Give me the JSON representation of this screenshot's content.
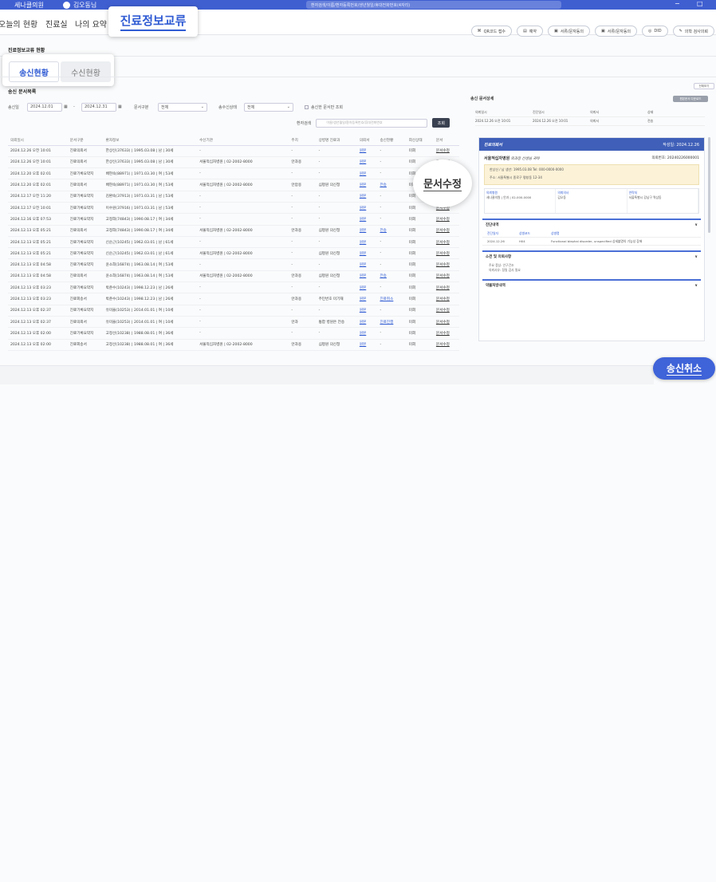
{
  "topbar": {
    "clinic_name": "세나클의원",
    "user_name": "김오동님",
    "search_placeholder": "환자검색/이름/환자등록번호/생년월일/휴대전화번호(4자리)",
    "minimize": "−",
    "maximize": "□"
  },
  "menu": {
    "items": [
      "오늘의 현황",
      "진료실",
      "나의 요약"
    ],
    "active": "진료정보교류"
  },
  "actions": [
    {
      "icon": "qr-icon",
      "glyph": "⌘",
      "label": "QR코드 접수"
    },
    {
      "icon": "print-icon",
      "glyph": "▤",
      "label": "예약"
    },
    {
      "icon": "doc-icon",
      "glyph": "▣",
      "label": "서류/문자동의"
    },
    {
      "icon": "doc2-icon",
      "glyph": "▣",
      "label": "서류/문자동의"
    },
    {
      "icon": "did-icon",
      "glyph": "◎",
      "label": "DID"
    },
    {
      "icon": "pen-icon",
      "glyph": "✎",
      "label": "의학 검사의뢰"
    }
  ],
  "page": {
    "title": "진료정보교류 현황",
    "tabs": {
      "sent": "송신현황",
      "received": "수신현황"
    },
    "small_right_button": "전체보기"
  },
  "list": {
    "title": "송신 문서목록",
    "filters": {
      "send_date_label": "송신일",
      "date_from": "2024.12.01",
      "date_to": "2024.12.31",
      "doc_type_label": "문서구분",
      "doc_type_value": "전체",
      "status_label": "송수신상태",
      "status_value": "전체",
      "checkbox_label": "송신한 문서만 조회"
    },
    "search": {
      "label": "환자검색",
      "placeholder": "이름/생년월일/환자등록번호/휴대전화번호",
      "button": "조회"
    },
    "columns": [
      "의뢰일시",
      "문서구분",
      "환자정보",
      "수신기관",
      "주치",
      "상병명 진료과",
      "의뢰서",
      "송신현황",
      "회신상태",
      "문서"
    ],
    "rows": [
      [
        "2024.12.26 오전 10:01",
        "진료의뢰서",
        "한상신(37633) | 1995.03.08 | 남 | 30세",
        "-",
        "-",
        "-",
        "원본",
        "-",
        "미회",
        "문서수정"
      ],
      [
        "2024.12.26 오전 10:01",
        "진료의뢰서",
        "한상신(37633) | 1995.03.08 | 남 | 30세",
        "서울적십자병원 | 02-2002-8000",
        "안과용",
        "-",
        "원본",
        "-",
        "미회",
        "문서수정"
      ],
      [
        "2024.12.20 오후 02:01",
        "진료기록요약지",
        "배현숙(88971) | 1971.03.30 | 여 | 53세",
        "-",
        "-",
        "-",
        "원본",
        "-",
        "미회",
        "문서수정"
      ],
      [
        "2024.12.20 오후 02:01",
        "진료의뢰서",
        "배현숙(88971) | 1971.03.30 | 여 | 53세",
        "서울적십자병원 | 02-2002-8000",
        "안압용",
        "심평원 의신청",
        "원본",
        "전송",
        "미회",
        "문서수정"
      ],
      [
        "2024.12.17 오전 11:20",
        "진료기록요약지",
        "김환숙(37913) | 1971.03.31 | 남 | 53세",
        "-",
        "-",
        "-",
        "원본",
        "-",
        "미회",
        "문서수정"
      ],
      [
        "2024.12.17 오전 10:01",
        "진료기록요약지",
        "이수원(37916) | 1971.03.31 | 남 | 53세",
        "-",
        "-",
        "-",
        "원본",
        "-",
        "미회",
        "문서수정"
      ],
      [
        "2024.12.16 오후 07:53",
        "진료기록요약지",
        "고정희(74843) | 1990.08.17 | 여 | 34세",
        "-",
        "-",
        "-",
        "원본",
        "-",
        "미회",
        "문서수정"
      ],
      [
        "2024.12.13 오후 05:21",
        "진료의뢰서",
        "고정희(74843) | 1990.08.17 | 여 | 34세",
        "서울적십자병원 | 02-2002-8000",
        "안과용",
        "심평원 의신청",
        "원본",
        "전송",
        "미회",
        "문서수정"
      ],
      [
        "2024.12.13 오후 05:21",
        "진료기록요약지",
        "신순근(10245) | 1962.03.01 | 남 | 61세",
        "-",
        "-",
        "-",
        "원본",
        "-",
        "미회",
        "문서수정"
      ],
      [
        "2024.12.13 오후 05:21",
        "진료기록요약지",
        "신순근(10245) | 1962.03.01 | 남 | 61세",
        "서울적십자병원 | 02-2002-8000",
        "-",
        "심평원 의신청",
        "원본",
        "-",
        "미회",
        "문서수정"
      ],
      [
        "2024.12.13 오후 04:58",
        "진료기록요약지",
        "윤소희(16874) | 1963.08.14 | 여 | 53세",
        "-",
        "-",
        "-",
        "원본",
        "-",
        "미회",
        "문서수정"
      ],
      [
        "2024.12.13 오후 04:58",
        "진료의뢰서",
        "윤소희(16874) | 1963.08.14 | 여 | 53세",
        "서울적십자병원 | 02-2002-8000",
        "안과용",
        "심평원 의신청",
        "원본",
        "전송",
        "미회",
        "문서수정"
      ],
      [
        "2024.12.13 오후 03:23",
        "진료기록요약지",
        "박춘수(10243) | 1998.12.23 | 남 | 26세",
        "-",
        "-",
        "-",
        "원본",
        "-",
        "미회",
        "문서수정"
      ],
      [
        "2024.12.13 오후 03:23",
        "진료회송서",
        "박춘수(10243) | 1998.12.23 | 남 | 26세",
        "-",
        "안과용",
        "주민번호 미기재",
        "원본",
        "진료취소",
        "미회",
        "문서수정"
      ],
      [
        "2024.12.13 오후 02:37",
        "진료기록요약지",
        "유미을(10253) | 2014.01.01 | 여 | 10세",
        "-",
        "-",
        "-",
        "원본",
        "-",
        "미회",
        "문서수정"
      ],
      [
        "2024.12.13 오후 02:37",
        "진료의뢰서",
        "유미을(10253) | 2014.01.01 | 여 | 10세",
        "-",
        "안과",
        "통합 병원은 전송",
        "원본",
        "진료진행",
        "미회",
        "문서수정"
      ],
      [
        "2024.12.13 오후 02:00",
        "진료기록요약지",
        "고정선(10238) | 1988.08.01 | 여 | 36세",
        "-",
        "-",
        "-",
        "원본",
        "-",
        "미회",
        "문서수정"
      ],
      [
        "2024.12.13 오후 02:00",
        "진료회송서",
        "고정선(10238) | 1988.08.01 | 여 | 36세",
        "서울적십자병원 | 02-2002-8000",
        "안과용",
        "심평원 의신청",
        "원본",
        "-",
        "미회",
        "문서수정"
      ]
    ],
    "zoom_label": "문서수정"
  },
  "detail": {
    "title": "송신 문서상세",
    "top_button": "원본문서 다운로드",
    "info_headers": [
      "의뢰일시",
      "진단일시",
      "의뢰서",
      "상태"
    ],
    "info_values": [
      "2024.12.26 오전 10:01",
      "2024.12.26 오전 10:01",
      "의뢰서",
      "전송"
    ],
    "doc_header_title": "진료의뢰서",
    "doc_header_date": "작성일: 2024.12.26",
    "hospital": "서울적십자병원",
    "doctor": "외과장 선생님 귀하",
    "doc_no": "의뢰번호: 20240226000001",
    "address_line1": "한상신 / 남   생년: 1995.03.08   Tel: 000-0000-0000",
    "address_line2": "주소: 서울특별시 종로구 평창동 12-34",
    "patient_cols": [
      {
        "label": "의뢰병원",
        "value": "세나클의원 | 안과 | 02-000-0000"
      },
      {
        "label": "의뢰의사",
        "value": "김오동"
      },
      {
        "label": "연락처",
        "value": "서울특별시 강남구 역삼동"
      }
    ],
    "sections": [
      {
        "title": "진단내역",
        "toggle": "∨"
      },
      {
        "title": "소견 및 의뢰사항",
        "toggle": "∨"
      },
      {
        "title": "약물처방내역",
        "toggle": "∨"
      }
    ],
    "diag_headers": [
      "진단일자",
      "상병코드",
      "상병명"
    ],
    "diag_row": [
      "2024.12.26",
      "H04",
      "Functional blephal disorder, unspecified 상세불명의 기능성 장애"
    ],
    "note_lines": [
      "주요 증상: 안구건조",
      "의뢰사유: 정밀 검사 필요"
    ]
  },
  "cancel_button": "송신취소"
}
